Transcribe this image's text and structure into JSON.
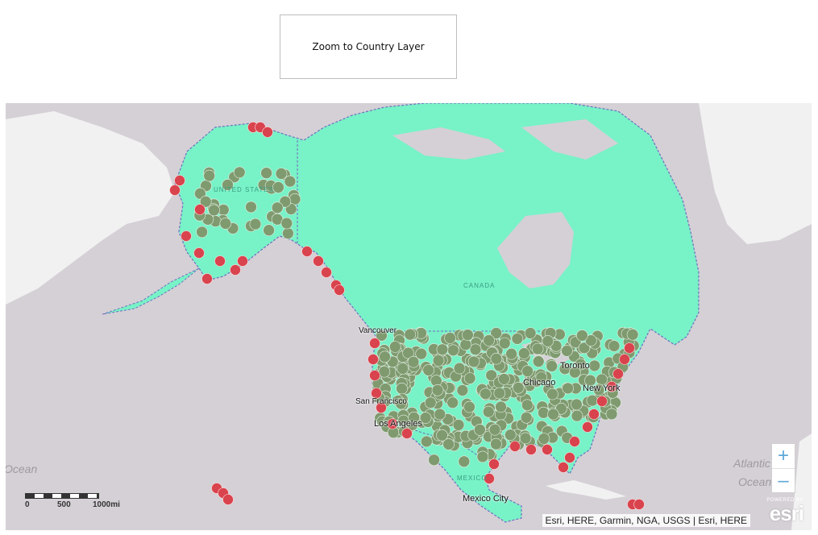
{
  "toolbar": {
    "zoom_button_label": "Zoom to Country Layer"
  },
  "map": {
    "country_labels": [
      "UNITED STATES",
      "CANADA",
      "MEXICO"
    ],
    "city_labels": [
      "Vancouver",
      "San Francisco",
      "Los Angeles",
      "Chicago",
      "Toronto",
      "New York",
      "Mexico City"
    ],
    "ocean_labels": {
      "pacific": "Ocean",
      "atlantic_1": "Atlantic",
      "atlantic_2": "Ocean"
    },
    "zoom_in": "+",
    "zoom_out": "–",
    "scalebar": {
      "labels": [
        "0",
        "500",
        "1000mi"
      ]
    },
    "attribution": "Esri, HERE, Garmin, NGA, USGS | Esri, HERE",
    "logo": {
      "powered_by": "POWERED BY",
      "name": "esri"
    },
    "colors": {
      "water": "#d5d0d6",
      "land": "#f1f1f1",
      "country_fill": "#78f2c7",
      "coastal_point": "#d9434d",
      "inland_point": "#7f9a6f"
    },
    "icons": [
      "zoom-in-icon",
      "zoom-out-icon"
    ]
  }
}
